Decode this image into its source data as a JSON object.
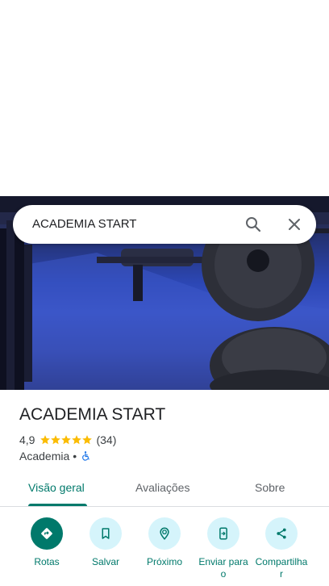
{
  "search": {
    "query": "ACADEMIA START"
  },
  "place": {
    "name": "ACADEMIA START",
    "rating": "4,9",
    "reviews_count": "(34)",
    "category": "Academia",
    "separator": "•",
    "stars_filled": 5
  },
  "tabs": [
    {
      "label": "Visão geral",
      "active": true
    },
    {
      "label": "Avaliações",
      "active": false
    },
    {
      "label": "Sobre",
      "active": false
    }
  ],
  "actions": [
    {
      "label": "Rotas",
      "icon": "directions-icon"
    },
    {
      "label": "Salvar",
      "icon": "bookmark-icon"
    },
    {
      "label": "Próximo",
      "icon": "nearby-icon"
    },
    {
      "label": "Enviar para\no",
      "icon": "send-to-phone-icon"
    },
    {
      "label": "Compartilha\nr",
      "icon": "share-icon"
    }
  ],
  "colors": {
    "accent": "#00796b",
    "action_bg": "#d5f4fb",
    "star": "#fbbc04",
    "accessibility": "#1a73e8"
  }
}
